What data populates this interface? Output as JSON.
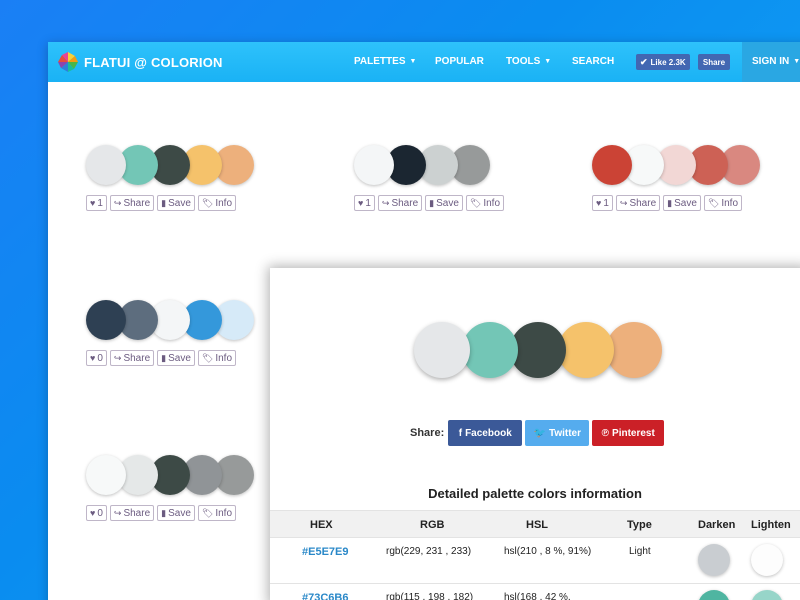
{
  "nav": {
    "brand": "FLATUI @ COLORION",
    "palettes": "PALETTES",
    "popular": "POPULAR",
    "tools": "TOOLS",
    "search": "SEARCH",
    "like": "Like 2.3K",
    "share": "Share",
    "signin": "SIGN IN"
  },
  "palettes": [
    {
      "colors": [
        "#e5e7e9",
        "#73c6b6",
        "#3d4a46",
        "#f5c26b",
        "#edb07c"
      ],
      "likes": "1"
    },
    {
      "colors": [
        "#f4f6f7",
        "#1b2631",
        "#ccd1d1",
        "#979a9a"
      ],
      "likes": "1"
    },
    {
      "colors": [
        "#cb4335",
        "#f7f9f9",
        "#f2d7d5",
        "#cd6155",
        "#d98880"
      ],
      "likes": "1"
    },
    {
      "colors": [
        "#2e4053",
        "#5d6d7e",
        "#f4f6f7",
        "#3498db",
        "#d6eaf8"
      ],
      "likes": "0"
    },
    {
      "colors": [
        "#f7f9f9",
        "#e5e8e8",
        "#3d4a46",
        "#909497",
        "#979a9a"
      ],
      "likes": "0"
    }
  ],
  "actions": {
    "share": "Share",
    "save": "Save",
    "info": "Info"
  },
  "detail": {
    "colors": [
      "#e5e7e9",
      "#73c6b6",
      "#3d4a46",
      "#f5c26b",
      "#edb07c"
    ],
    "share_label": "Share:",
    "facebook": "Facebook",
    "twitter": "Twitter",
    "pinterest": "Pinterest",
    "section_title": "Detailed palette colors information",
    "headers": {
      "hex": "HEX",
      "rgb": "RGB",
      "hsl": "HSL",
      "type": "Type",
      "darken": "Darken",
      "lighten": "Lighten"
    },
    "rows": [
      {
        "hex": "#E5E7E9",
        "rgb": "rgb(229, 231 , 233)",
        "hsl": "hsl(210 , 8 %, 91%)",
        "type": "Light",
        "darken": "#c9cdd1",
        "lighten": "#fdfdfd"
      },
      {
        "hex": "#73C6B6",
        "rgb": "rgb(115 , 198 , 182)",
        "hsl": "hsl(168 , 42 %,",
        "type": "",
        "darken": "#4fb5a1",
        "lighten": "#97d5c9"
      }
    ]
  },
  "colors": {
    "facebook": "#3b5998",
    "twitter": "#55acee",
    "pinterest": "#cb2027"
  }
}
